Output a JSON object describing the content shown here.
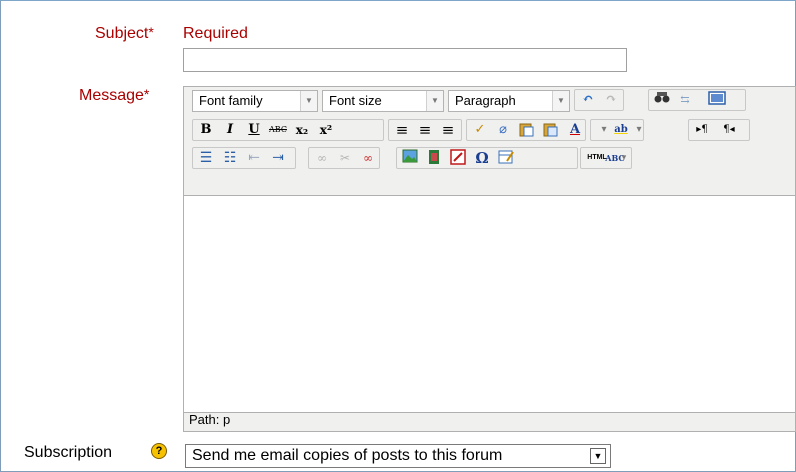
{
  "subject": {
    "label": "Subject",
    "required_mark": "*",
    "required_text": "Required",
    "value": ""
  },
  "message": {
    "label": "Message",
    "required_mark": "*",
    "font_family": "Font family",
    "font_size": "Font size",
    "format": "Paragraph",
    "path_label": "Path: p",
    "toolbar2": {
      "bold": "B",
      "italic": "I",
      "underline": "U",
      "strike": "ABC",
      "sub": "x₂",
      "sup": "x²"
    },
    "special_char": "Ω",
    "spell_label": "HTML",
    "spell_abc": "ABC"
  },
  "subscription": {
    "label": "Subscription",
    "help": "?",
    "selected": "Send me email copies of posts to this forum",
    "arrow": "▼"
  }
}
